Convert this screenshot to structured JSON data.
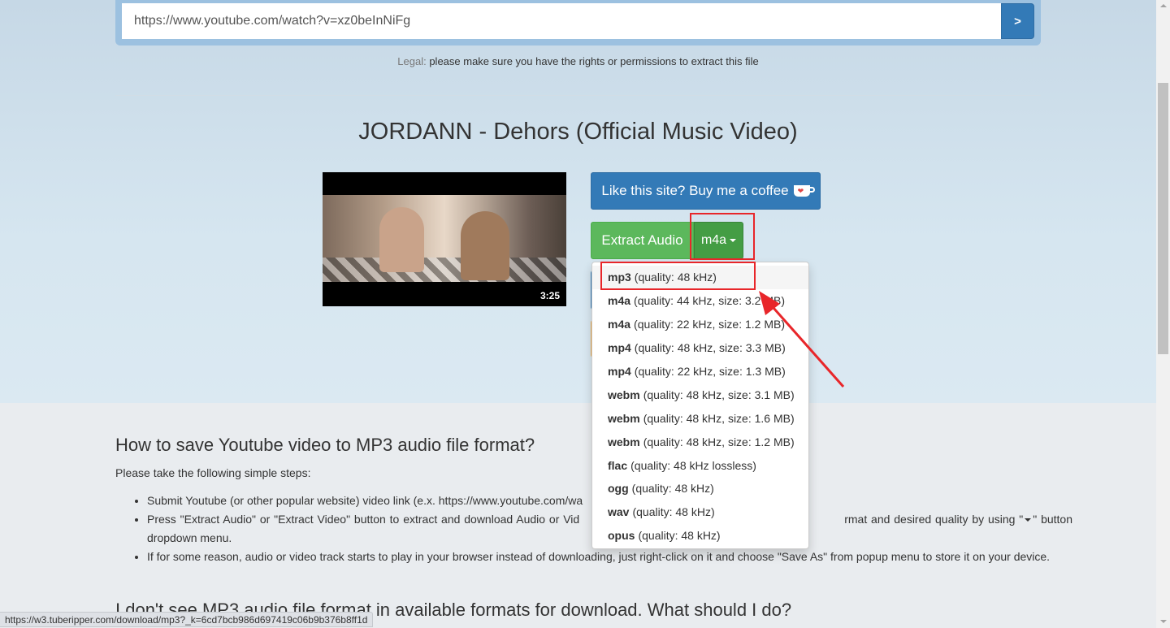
{
  "search": {
    "url_value": "https://www.youtube.com/watch?v=xz0beInNiFg",
    "go_label": ">"
  },
  "legal": {
    "label": "Legal:",
    "text": " please make sure you have the rights or permissions to extract this file"
  },
  "video": {
    "title": "JORDANN - Dehors (Official Music Video)",
    "duration": "3:25"
  },
  "buttons": {
    "coffee_label": "Like this site? Buy me a coffee",
    "extract_label": "Extract Audio",
    "format_selected": "m4a"
  },
  "dropdown": {
    "items": [
      {
        "format": "mp3",
        "detail": "(quality: 48 kHz)"
      },
      {
        "format": "m4a",
        "detail": "(quality: 44 kHz, size: 3.2 MB)"
      },
      {
        "format": "m4a",
        "detail": "(quality: 22 kHz, size: 1.2 MB)"
      },
      {
        "format": "mp4",
        "detail": "(quality: 48 kHz, size: 3.3 MB)"
      },
      {
        "format": "mp4",
        "detail": "(quality: 22 kHz, size: 1.3 MB)"
      },
      {
        "format": "webm",
        "detail": "(quality: 48 kHz, size: 3.1 MB)"
      },
      {
        "format": "webm",
        "detail": "(quality: 48 kHz, size: 1.6 MB)"
      },
      {
        "format": "webm",
        "detail": "(quality: 48 kHz, size: 1.2 MB)"
      },
      {
        "format": "flac",
        "detail": "(quality: 48 kHz lossless)"
      },
      {
        "format": "ogg",
        "detail": "(quality: 48 kHz)"
      },
      {
        "format": "wav",
        "detail": "(quality: 48 kHz)"
      },
      {
        "format": "opus",
        "detail": "(quality: 48 kHz)"
      }
    ]
  },
  "howto": {
    "heading": "How to save Youtube video to MP3 audio file format?",
    "intro": "Please take the following simple steps:",
    "steps": [
      "Submit Youtube (or other popular website) video link (e.x. https://www.youtube.com/wa",
      "Press \"Extract Audio\" or \"Extract Video\" button to extract and download Audio or Vid",
      "rmat and desired quality by using \"",
      "\" button dropdown menu.",
      "If for some reason, audio or video track starts to play in your browser instead of downloading, just right-click on it and choose \"Save As\" from popup menu to store it on your device."
    ]
  },
  "faq": {
    "heading": "I don't see MP3 audio file format in available formats for download. What should I do?"
  },
  "status_bar": {
    "url": "https://w3.tuberipper.com/download/mp3?_k=6cd7bcb986d697419c06b9b376b8ff1d"
  },
  "colors": {
    "primary": "#337ab7",
    "success": "#5cb85c",
    "success_dark": "#449d44",
    "annotation": "#e8262a"
  }
}
